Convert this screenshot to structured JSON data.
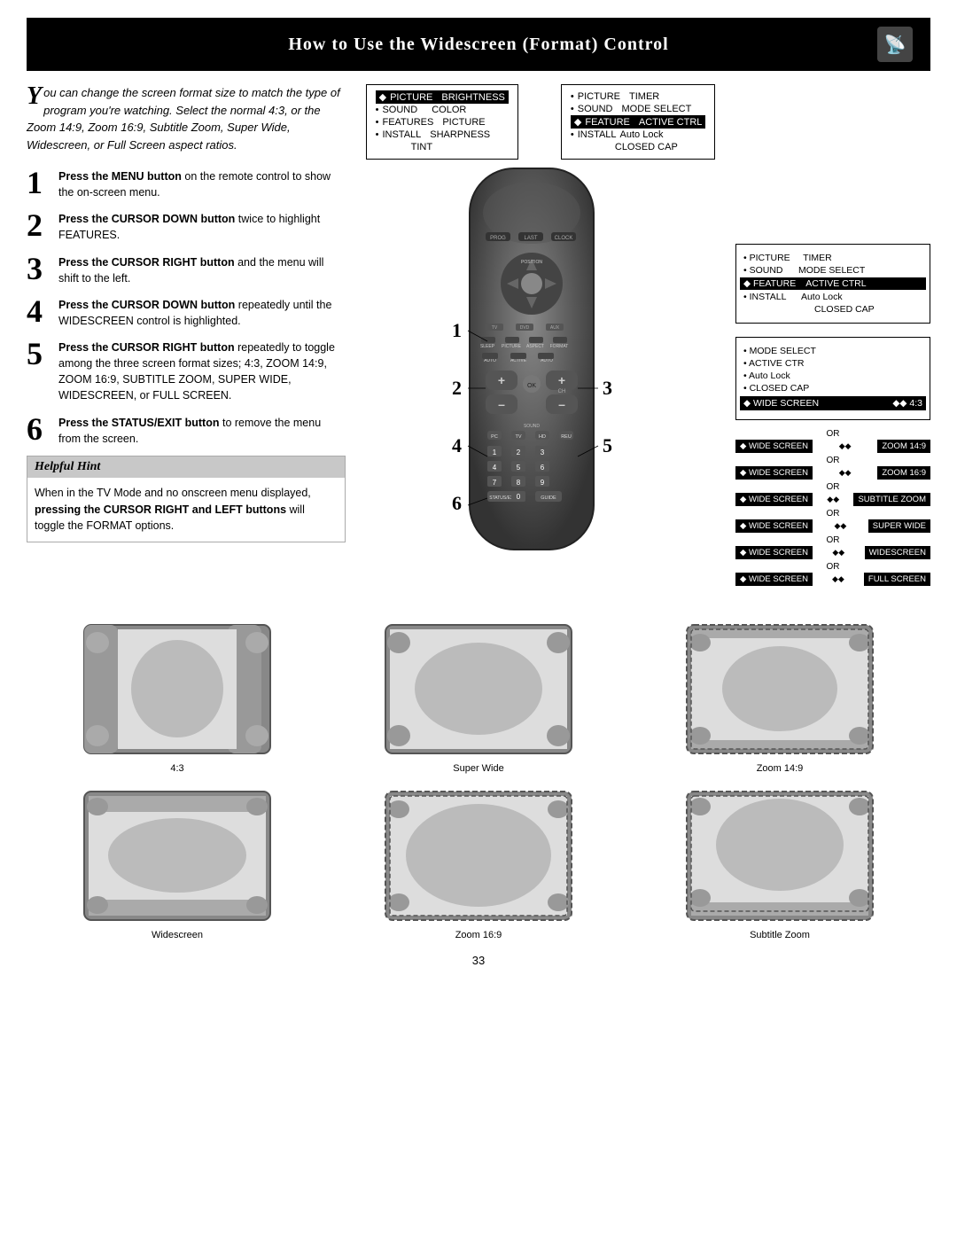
{
  "header": {
    "title": "How to Use the Widescreen (Format) Control",
    "icon": "📡"
  },
  "intro": {
    "drop_cap": "Y",
    "text": "ou can change the screen format size to match the type of program you're watching. Select the normal 4:3, or the Zoom 14:9, Zoom 16:9, Subtitle Zoom, Super Wide, Widescreen, or Full Screen aspect ratios."
  },
  "steps": [
    {
      "number": "1",
      "bold": "Press the MENU button",
      "rest": " on the remote control to show the on-screen menu."
    },
    {
      "number": "2",
      "bold": "Press the CURSOR DOWN button",
      "rest": " twice to highlight FEATURES."
    },
    {
      "number": "3",
      "bold": "Press the CURSOR RIGHT button",
      "rest": " and the menu will shift to the left."
    },
    {
      "number": "4",
      "bold": "Press the CURSOR DOWN button",
      "rest": " repeatedly until the WIDESCREEN control is highlighted."
    },
    {
      "number": "5",
      "bold": "Press the CURSOR RIGHT button",
      "rest": " repeatedly to toggle among the three screen format sizes; 4:3, ZOOM 14:9, ZOOM 16:9, SUBTITLE ZOOM, SUPER WIDE, WIDESCREEN, or FULL SCREEN."
    },
    {
      "number": "6",
      "bold": "Press the STATUS/EXIT button",
      "rest": " to remove the menu from the screen."
    }
  ],
  "hint": {
    "title": "Helpful Hint",
    "text": "When in the TV Mode and no onscreen menu displayed, ",
    "bold1": "pressing the CURSOR RIGHT and LEFT buttons",
    "text2": " will toggle the FORMAT options."
  },
  "menu1": {
    "items": [
      {
        "label": "◆ PICTURE",
        "right": "BRIGHTNESS",
        "selected": true
      },
      {
        "label": "• SOUND",
        "right": "COLOR",
        "selected": false
      },
      {
        "label": "• FEATURES",
        "right": "PICTURE",
        "selected": false
      },
      {
        "label": "• INSTALL",
        "right": "SHARPNESS",
        "selected": false
      },
      {
        "label": "",
        "right": "TINT",
        "selected": false
      }
    ]
  },
  "menu2": {
    "items": [
      {
        "label": "• PICTURE",
        "right": "TIMER"
      },
      {
        "label": "• SOUND",
        "right": "MODE SELECT"
      },
      {
        "label": "◆ FEATURE",
        "right": "ACTIVE CTRL",
        "selected": true
      },
      {
        "label": "• INSTALL",
        "right": "Auto Lock"
      },
      {
        "label": "",
        "right": "CLOSED CAP"
      }
    ]
  },
  "options_box": {
    "items": [
      {
        "label": "• MODE SELECT"
      },
      {
        "label": "• ACTIVE CTR"
      },
      {
        "label": "• Auto Lock"
      },
      {
        "label": "• CLOSED CAP"
      },
      {
        "label": "◆ WIDE SCREEN",
        "right": "◆◆ 4:3",
        "selected": true
      }
    ]
  },
  "wide_options": [
    {
      "left": "◆ WIDE SCREEN",
      "right": "◆◆ ZOOM 14:9"
    },
    {
      "left": "◆ WIDE SCREEN",
      "right": "◆◆ ZOOM 16:9"
    },
    {
      "left": "◆ WIDE SCREEN",
      "right": "◆◆ SUBTITLE ZOOM"
    },
    {
      "left": "◆ WIDE SCREEN",
      "right": "◆◆ SUPER WIDE"
    },
    {
      "left": "◆ WIDE SCREEN",
      "right": "◆◆ WIDESCREEN"
    },
    {
      "left": "◆ WIDE SCREEN",
      "right": "◆◆ FULL SCREEN"
    }
  ],
  "format_row1": [
    {
      "label": "4:3",
      "type": "normal"
    },
    {
      "label": "Super Wide",
      "type": "wide"
    },
    {
      "label": "Zoom 14:9",
      "type": "zoom149",
      "dashed": true
    }
  ],
  "format_row2": [
    {
      "label": "Widescreen",
      "type": "widescreen"
    },
    {
      "label": "Zoom 16:9",
      "type": "zoom169",
      "dashed": true
    },
    {
      "label": "Subtitle Zoom",
      "type": "subtitle",
      "dashed": true
    }
  ],
  "page_number": "33"
}
